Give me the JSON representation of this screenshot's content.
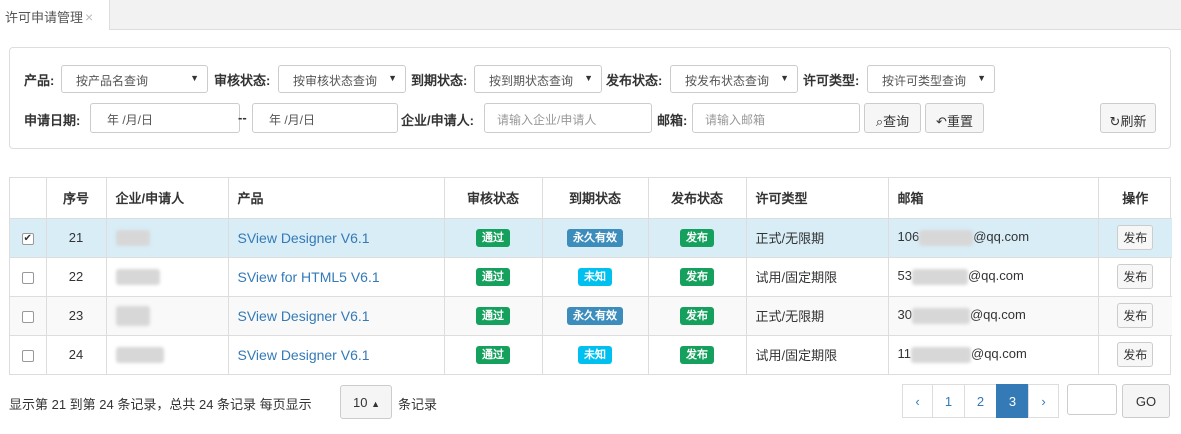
{
  "tab": {
    "title": "许可申请管理",
    "close": "×"
  },
  "filters": {
    "product": {
      "label": "产品:",
      "value": "按产品名查询"
    },
    "review": {
      "label": "审核状态:",
      "value": "按审核状态查询"
    },
    "expire": {
      "label": "到期状态:",
      "value": "按到期状态查询"
    },
    "publish": {
      "label": "发布状态:",
      "value": "按发布状态查询"
    },
    "license_type": {
      "label": "许可类型:",
      "value": "按许可类型查询"
    },
    "apply_date": {
      "label": "申请日期:",
      "from_placeholder": "年 /月/日",
      "sep": "--",
      "to_placeholder": "年 /月/日"
    },
    "company": {
      "label": "企业/申请人:",
      "placeholder": "请输入企业/申请人"
    },
    "email": {
      "label": "邮箱:",
      "placeholder": "请输入邮箱"
    },
    "query_button": "查询",
    "reset_button": "重置",
    "refresh_button": "刷新"
  },
  "table": {
    "headers": [
      "序号",
      "企业/申请人",
      "产品",
      "审核状态",
      "到期状态",
      "发布状态",
      "许可类型",
      "邮箱",
      "操作"
    ],
    "rows": [
      {
        "checked": true,
        "seq": "21",
        "product": "SView Designer V6.1",
        "review": "通过",
        "expire": "永久有效",
        "publish": "发布",
        "type": "正式/无限期",
        "email_prefix": "106",
        "email_suffix": "@qq.com",
        "action": "发布"
      },
      {
        "checked": false,
        "seq": "22",
        "product": "SView for HTML5 V6.1",
        "review": "通过",
        "expire": "未知",
        "publish": "发布",
        "type": "试用/固定期限",
        "email_prefix": "53",
        "email_suffix": "@qq.com",
        "action": "发布"
      },
      {
        "checked": false,
        "seq": "23",
        "product": "SView Designer V6.1",
        "review": "通过",
        "expire": "永久有效",
        "publish": "发布",
        "type": "正式/无限期",
        "email_prefix": "30",
        "email_suffix": "@qq.com",
        "action": "发布"
      },
      {
        "checked": false,
        "seq": "24",
        "product": "SView Designer V6.1",
        "review": "通过",
        "expire": "未知",
        "publish": "发布",
        "type": "试用/固定期限",
        "email_prefix": "11",
        "email_suffix": "@qq.com",
        "action": "发布"
      }
    ]
  },
  "footer": {
    "summary": "显示第 21 到第 24 条记录，总共 24 条记录 每页显示",
    "page_size": "10",
    "suffix": "条记录",
    "prev": "‹",
    "pages": [
      "1",
      "2",
      "3"
    ],
    "current_page": "3",
    "next": "›",
    "go": "GO"
  },
  "colors": {
    "approved": "#16a05d",
    "permanent": "#3c8dbc",
    "unknown": "#00c0ef",
    "link": "#337ab7",
    "selected_row": "#d9edf7"
  }
}
